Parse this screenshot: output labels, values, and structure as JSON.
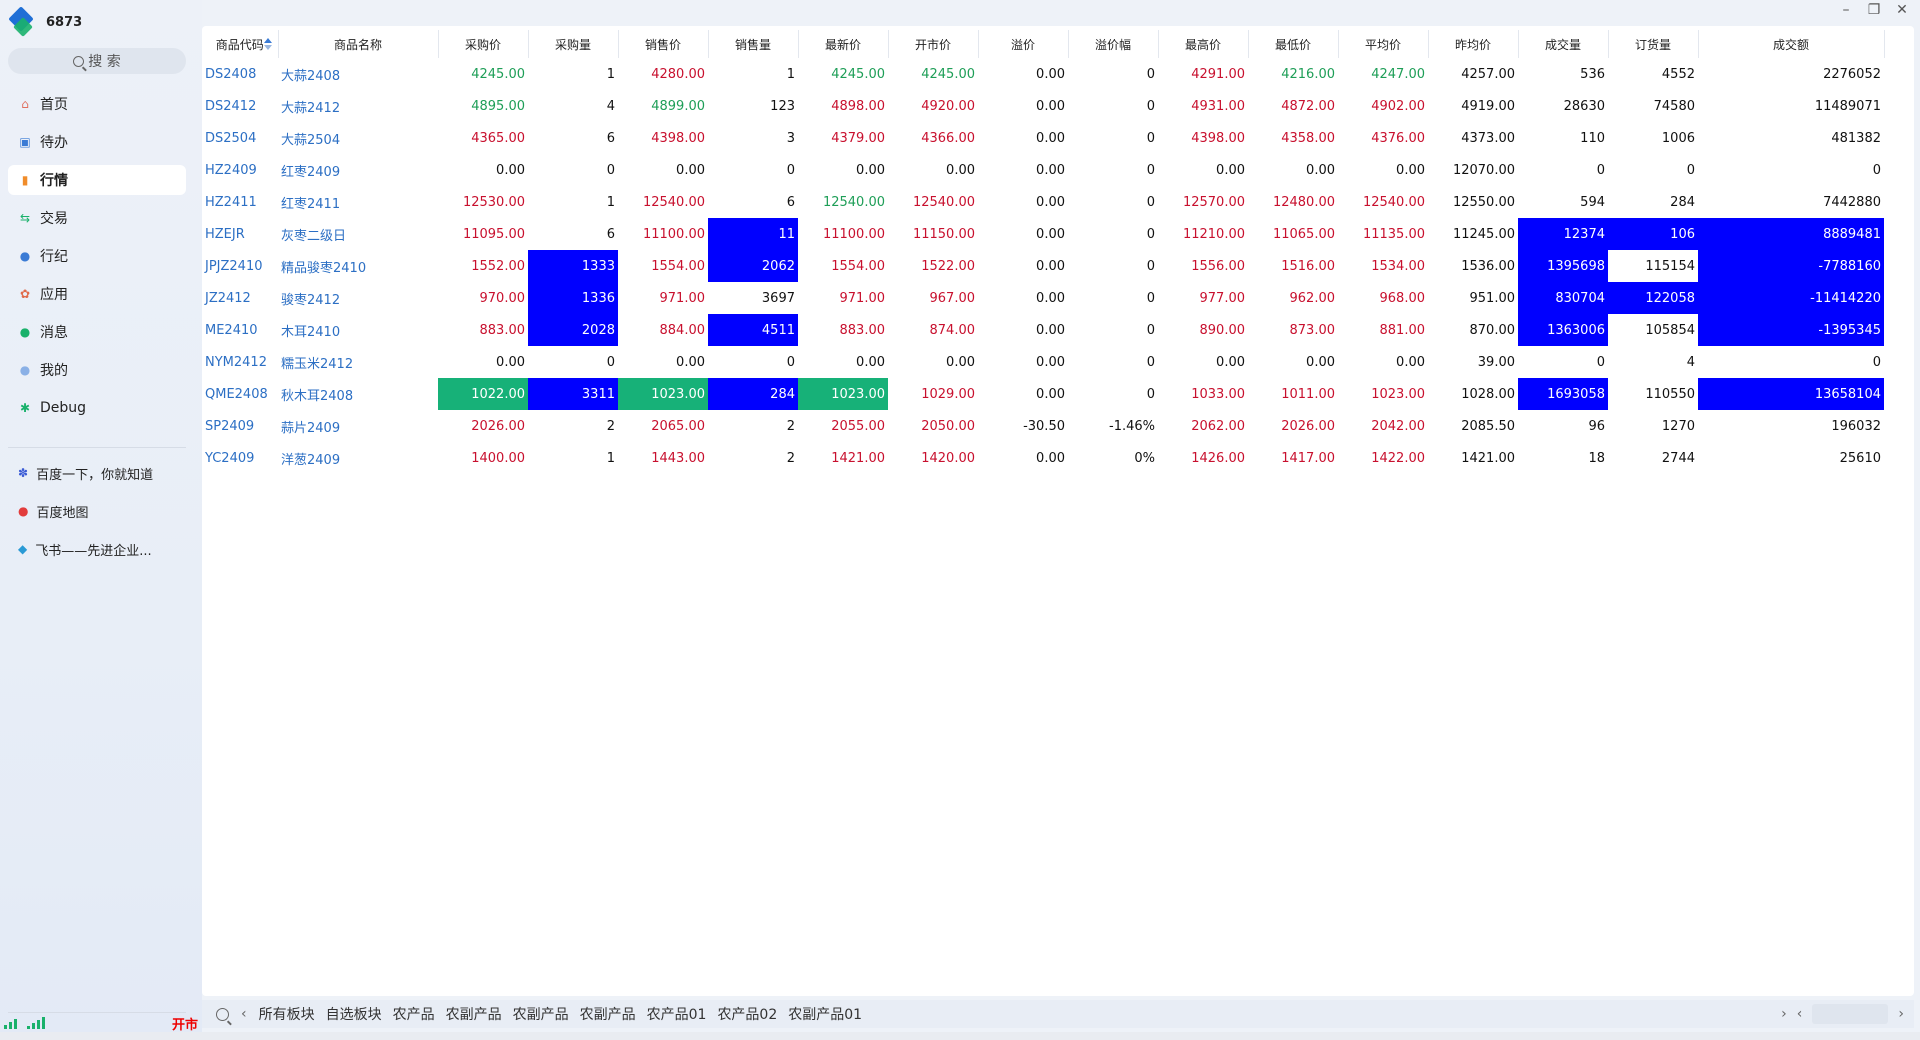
{
  "app": {
    "title": "6873"
  },
  "search": {
    "label": "搜 索"
  },
  "nav": [
    {
      "label": "首页",
      "icon": "home-icon",
      "active": false
    },
    {
      "label": "待办",
      "icon": "todo-icon",
      "active": false
    },
    {
      "label": "行情",
      "icon": "market-icon",
      "active": true
    },
    {
      "label": "交易",
      "icon": "trade-icon",
      "active": false
    },
    {
      "label": "行纪",
      "icon": "broker-icon",
      "active": false
    },
    {
      "label": "应用",
      "icon": "apps-icon",
      "active": false
    },
    {
      "label": "消息",
      "icon": "message-icon",
      "active": false
    },
    {
      "label": "我的",
      "icon": "user-icon",
      "active": false
    },
    {
      "label": "Debug",
      "icon": "bug-icon",
      "active": false
    }
  ],
  "bookmarks": [
    {
      "label": "百度一下，你就知道",
      "icon": "baidu-paw-icon"
    },
    {
      "label": "百度地图",
      "icon": "map-pin-icon"
    },
    {
      "label": "飞书——先进企业...",
      "icon": "feishu-icon"
    }
  ],
  "status": {
    "market_state": "开市"
  },
  "colors": {
    "up": "#c8102e",
    "down": "#1e9e57",
    "highlight_blue": "#0000ff",
    "highlight_green": "#17b178",
    "link": "#2c6fc4"
  },
  "table": {
    "columns": [
      "商品代码",
      "商品名称",
      "采购价",
      "采购量",
      "销售价",
      "销售量",
      "最新价",
      "开市价",
      "溢价",
      "溢价幅",
      "最高价",
      "最低价",
      "平均价",
      "昨均价",
      "成交量",
      "订货量",
      "成交额"
    ],
    "rows": [
      {
        "cells": [
          "DS2408",
          "大蒜2408",
          "4245.00",
          "1",
          "4280.00",
          "1",
          "4245.00",
          "4245.00",
          "0.00",
          "0",
          "4291.00",
          "4216.00",
          "4247.00",
          "4257.00",
          "536",
          "4552",
          "2276052"
        ],
        "colors": [
          "",
          "",
          "down",
          "",
          "up",
          "",
          "down",
          "down",
          "",
          "",
          "up",
          "down",
          "down",
          "",
          "",
          "",
          ""
        ],
        "hl": {}
      },
      {
        "cells": [
          "DS2412",
          "大蒜2412",
          "4895.00",
          "4",
          "4899.00",
          "123",
          "4898.00",
          "4920.00",
          "0.00",
          "0",
          "4931.00",
          "4872.00",
          "4902.00",
          "4919.00",
          "28630",
          "74580",
          "11489071"
        ],
        "colors": [
          "",
          "",
          "down",
          "",
          "down",
          "",
          "up",
          "up",
          "",
          "",
          "up",
          "up",
          "up",
          "",
          "",
          "",
          ""
        ],
        "hl": {}
      },
      {
        "cells": [
          "DS2504",
          "大蒜2504",
          "4365.00",
          "6",
          "4398.00",
          "3",
          "4379.00",
          "4366.00",
          "0.00",
          "0",
          "4398.00",
          "4358.00",
          "4376.00",
          "4373.00",
          "110",
          "1006",
          "481382"
        ],
        "colors": [
          "",
          "",
          "up",
          "",
          "up",
          "",
          "up",
          "up",
          "",
          "",
          "up",
          "up",
          "up",
          "",
          "",
          "",
          ""
        ],
        "hl": {}
      },
      {
        "cells": [
          "HZ2409",
          "红枣2409",
          "0.00",
          "0",
          "0.00",
          "0",
          "0.00",
          "0.00",
          "0.00",
          "0",
          "0.00",
          "0.00",
          "0.00",
          "12070.00",
          "0",
          "0",
          "0"
        ],
        "colors": [
          "",
          "",
          "",
          "",
          "",
          "",
          "",
          "",
          "",
          "",
          "",
          "",
          "",
          "",
          "",
          "",
          ""
        ],
        "hl": {}
      },
      {
        "cells": [
          "HZ2411",
          "红枣2411",
          "12530.00",
          "1",
          "12540.00",
          "6",
          "12540.00",
          "12540.00",
          "0.00",
          "0",
          "12570.00",
          "12480.00",
          "12540.00",
          "12550.00",
          "594",
          "284",
          "7442880"
        ],
        "colors": [
          "",
          "",
          "up",
          "",
          "up",
          "",
          "down",
          "up",
          "",
          "",
          "up",
          "up",
          "up",
          "",
          "",
          "",
          ""
        ],
        "hl": {}
      },
      {
        "cells": [
          "HZEJR",
          "灰枣二级日",
          "11095.00",
          "6",
          "11100.00",
          "11",
          "11100.00",
          "11150.00",
          "0.00",
          "0",
          "11210.00",
          "11065.00",
          "11135.00",
          "11245.00",
          "12374",
          "106",
          "8889481"
        ],
        "colors": [
          "",
          "",
          "up",
          "",
          "up",
          "",
          "up",
          "up",
          "",
          "",
          "up",
          "up",
          "up",
          "",
          "",
          "",
          ""
        ],
        "hl": {
          "5": "blue",
          "14": "blue",
          "15": "blue",
          "16": "blue"
        }
      },
      {
        "cells": [
          "JPJZ2410",
          "精品骏枣2410",
          "1552.00",
          "1333",
          "1554.00",
          "2062",
          "1554.00",
          "1522.00",
          "0.00",
          "0",
          "1556.00",
          "1516.00",
          "1534.00",
          "1536.00",
          "1395698",
          "115154",
          "-7788160"
        ],
        "colors": [
          "",
          "",
          "up",
          "",
          "up",
          "",
          "up",
          "up",
          "",
          "",
          "up",
          "up",
          "up",
          "",
          "",
          "",
          ""
        ],
        "hl": {
          "3": "blue",
          "5": "blue",
          "14": "blue",
          "16": "blue"
        }
      },
      {
        "cells": [
          "JZ2412",
          "骏枣2412",
          "970.00",
          "1336",
          "971.00",
          "3697",
          "971.00",
          "967.00",
          "0.00",
          "0",
          "977.00",
          "962.00",
          "968.00",
          "951.00",
          "830704",
          "122058",
          "-11414220"
        ],
        "colors": [
          "",
          "",
          "up",
          "",
          "up",
          "",
          "up",
          "up",
          "",
          "",
          "up",
          "up",
          "up",
          "",
          "",
          "",
          ""
        ],
        "hl": {
          "3": "blue",
          "14": "blue",
          "15": "blue",
          "16": "blue"
        }
      },
      {
        "cells": [
          "ME2410",
          "木耳2410",
          "883.00",
          "2028",
          "884.00",
          "4511",
          "883.00",
          "874.00",
          "0.00",
          "0",
          "890.00",
          "873.00",
          "881.00",
          "870.00",
          "1363006",
          "105854",
          "-1395345"
        ],
        "colors": [
          "",
          "",
          "up",
          "",
          "up",
          "",
          "up",
          "up",
          "",
          "",
          "up",
          "up",
          "up",
          "",
          "",
          "",
          ""
        ],
        "hl": {
          "3": "blue",
          "5": "blue",
          "14": "blue",
          "16": "blue"
        }
      },
      {
        "cells": [
          "NYM2412",
          "糯玉米2412",
          "0.00",
          "0",
          "0.00",
          "0",
          "0.00",
          "0.00",
          "0.00",
          "0",
          "0.00",
          "0.00",
          "0.00",
          "39.00",
          "0",
          "4",
          "0"
        ],
        "colors": [
          "",
          "",
          "",
          "",
          "",
          "",
          "",
          "",
          "",
          "",
          "",
          "",
          "",
          "",
          "",
          "",
          ""
        ],
        "hl": {}
      },
      {
        "cells": [
          "QME2408",
          "秋木耳2408",
          "1022.00",
          "3311",
          "1023.00",
          "284",
          "1023.00",
          "1029.00",
          "0.00",
          "0",
          "1033.00",
          "1011.00",
          "1023.00",
          "1028.00",
          "1693058",
          "110550",
          "13658104"
        ],
        "colors": [
          "",
          "",
          "up",
          "",
          "up",
          "",
          "up",
          "up",
          "",
          "",
          "up",
          "up",
          "up",
          "",
          "",
          "",
          ""
        ],
        "hl": {
          "2": "green",
          "3": "blue",
          "4": "green",
          "5": "blue",
          "6": "green",
          "14": "blue",
          "16": "blue"
        }
      },
      {
        "cells": [
          "SP2409",
          "蒜片2409",
          "2026.00",
          "2",
          "2065.00",
          "2",
          "2055.00",
          "2050.00",
          "-30.50",
          "-1.46%",
          "2062.00",
          "2026.00",
          "2042.00",
          "2085.50",
          "96",
          "1270",
          "196032"
        ],
        "colors": [
          "",
          "",
          "up",
          "",
          "up",
          "",
          "up",
          "up",
          "",
          "",
          "up",
          "up",
          "up",
          "",
          "",
          "",
          ""
        ],
        "hl": {}
      },
      {
        "cells": [
          "YC2409",
          "洋葱2409",
          "1400.00",
          "1",
          "1443.00",
          "2",
          "1421.00",
          "1420.00",
          "0.00",
          "0%",
          "1426.00",
          "1417.00",
          "1422.00",
          "1421.00",
          "18",
          "2744",
          "25610"
        ],
        "colors": [
          "",
          "",
          "up",
          "",
          "up",
          "",
          "up",
          "up",
          "",
          "",
          "up",
          "up",
          "up",
          "",
          "",
          "",
          ""
        ],
        "hl": {}
      }
    ]
  },
  "bottom_tabs": [
    "所有板块",
    "自选板块",
    "农产品",
    "农副产品",
    "农副产品",
    "农副产品",
    "农产品01",
    "农产品02",
    "农副产品01"
  ]
}
